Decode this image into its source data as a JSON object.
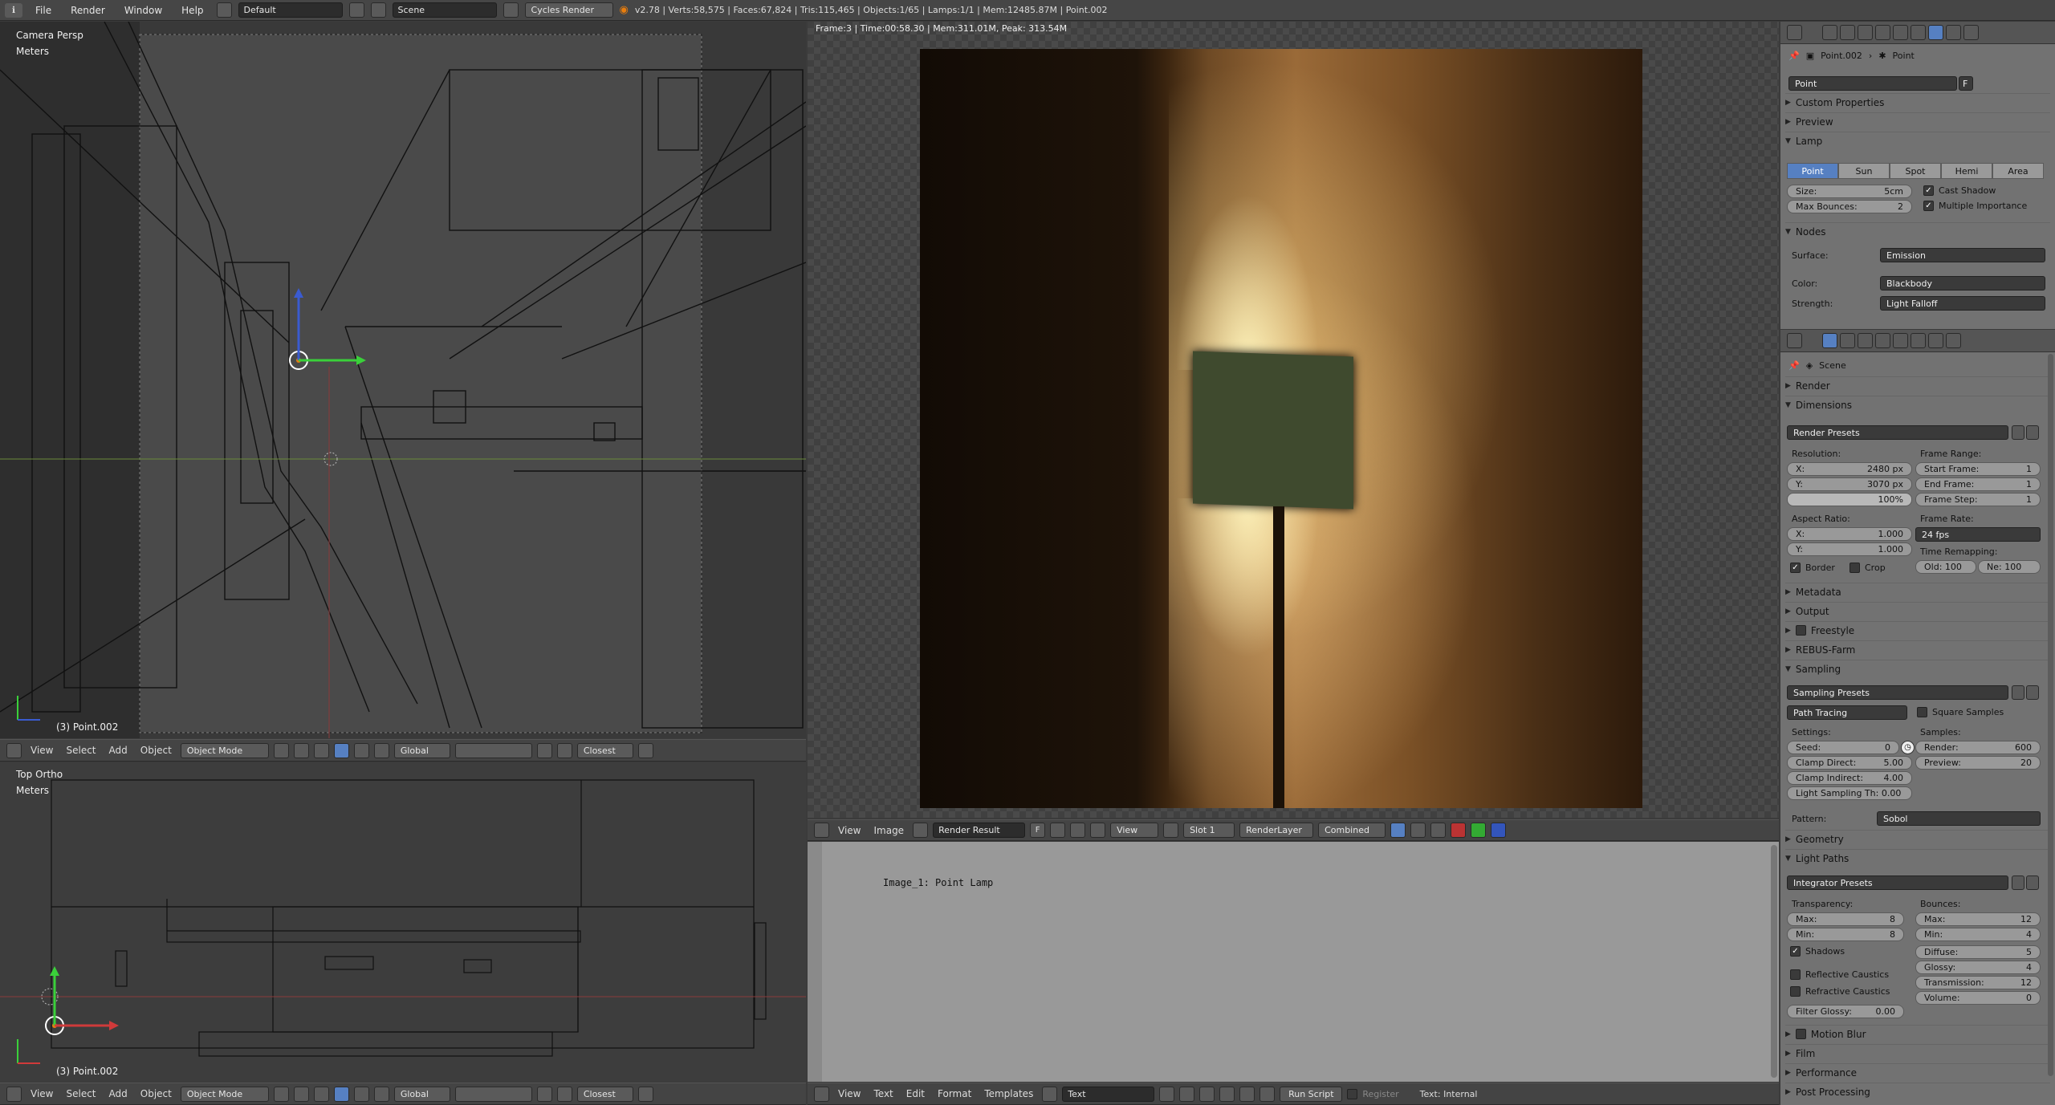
{
  "topbar": {
    "menus": [
      "File",
      "Render",
      "Window",
      "Help"
    ],
    "layout": "Default",
    "scene": "Scene",
    "engine": "Cycles Render",
    "stats": "v2.78 | Verts:58,575 | Faces:67,824 | Tris:115,465 | Objects:1/65 | Lamps:1/1 | Mem:12485.87M | Point.002"
  },
  "vp_top": {
    "title": "Camera Persp",
    "units": "Meters",
    "object": "(3) Point.002"
  },
  "vp_bottom": {
    "title": "Top Ortho",
    "units": "Meters",
    "object": "(3) Point.002"
  },
  "view3d_header": {
    "menus": [
      "View",
      "Select",
      "Add",
      "Object"
    ],
    "mode": "Object Mode",
    "orientation": "Global",
    "snap": "Closest"
  },
  "render": {
    "info": "Frame:3 | Time:00:58.30 | Mem:311.01M, Peak: 313.54M"
  },
  "image_header": {
    "menus": [
      "View",
      "Image"
    ],
    "image": "Render Result",
    "fake": "F",
    "view": "View",
    "slot": "Slot 1",
    "layer": "RenderLayer",
    "pass": "Combined"
  },
  "text_editor": {
    "content": "Image_1: Point Lamp"
  },
  "text_header": {
    "menus": [
      "View",
      "Text",
      "Edit",
      "Format",
      "Templates"
    ],
    "datablock": "Text",
    "run": "Run Script",
    "register": "Register",
    "status": "Text: Internal"
  },
  "lamp_props": {
    "breadcrumb_obj": "Point.002",
    "breadcrumb_lamp": "Point",
    "name": "Point",
    "fake": "F",
    "custom": "Custom Properties",
    "preview": "Preview",
    "lamp_section": "Lamp",
    "types": [
      "Point",
      "Sun",
      "Spot",
      "Hemi",
      "Area"
    ],
    "size_label": "Size:",
    "size_val": "5cm",
    "bounces_label": "Max Bounces:",
    "bounces_val": "2",
    "cast_shadow": "Cast Shadow",
    "multi_imp": "Multiple Importance",
    "nodes": "Nodes",
    "surface_label": "Surface:",
    "surface_val": "Emission",
    "color_label": "Color:",
    "color_val": "Blackbody",
    "strength_label": "Strength:",
    "strength_val": "Light Falloff"
  },
  "render_props": {
    "scene": "Scene",
    "render": "Render",
    "dimensions": "Dimensions",
    "render_presets": "Render Presets",
    "resolution": "Resolution:",
    "res_x_label": "X:",
    "res_x": "2480 px",
    "res_y_label": "Y:",
    "res_y": "3070 px",
    "res_pct": "100%",
    "frame_range": "Frame Range:",
    "start_label": "Start Frame:",
    "start": "1",
    "end_label": "End Frame:",
    "end": "1",
    "step_label": "Frame Step:",
    "step": "1",
    "aspect": "Aspect Ratio:",
    "asp_x_label": "X:",
    "asp_x": "1.000",
    "asp_y_label": "Y:",
    "asp_y": "1.000",
    "frame_rate": "Frame Rate:",
    "fps": "24 fps",
    "time_remap": "Time Remapping:",
    "old": "Old: 100",
    "new": "Ne: 100",
    "border": "Border",
    "crop": "Crop",
    "metadata": "Metadata",
    "output": "Output",
    "freestyle": "Freestyle",
    "rebus": "REBUS-Farm",
    "sampling": "Sampling",
    "sampling_presets": "Sampling Presets",
    "integrator": "Path Tracing",
    "square_samples": "Square Samples",
    "settings": "Settings:",
    "samples": "Samples:",
    "seed_label": "Seed:",
    "seed": "0",
    "clamp_d_label": "Clamp Direct:",
    "clamp_d": "5.00",
    "clamp_i_label": "Clamp Indirect:",
    "clamp_i": "4.00",
    "lsth": "Light Sampling Th: 0.00",
    "render_s_label": "Render:",
    "render_s": "600",
    "preview_s_label": "Preview:",
    "preview_s": "20",
    "pattern_label": "Pattern:",
    "pattern": "Sobol",
    "geometry": "Geometry",
    "light_paths": "Light Paths",
    "integrator_presets": "Integrator Presets",
    "transparency": "Transparency:",
    "bounces": "Bounces:",
    "t_max_label": "Max:",
    "t_max": "8",
    "t_min_label": "Min:",
    "t_min": "8",
    "b_max_label": "Max:",
    "b_max": "12",
    "b_min_label": "Min:",
    "b_min": "4",
    "shadows": "Shadows",
    "diffuse_label": "Diffuse:",
    "diffuse": "5",
    "glossy_label": "Glossy:",
    "glossy": "4",
    "transmission_label": "Transmission:",
    "transmission": "12",
    "volume_label": "Volume:",
    "volume": "0",
    "refl_caustics": "Reflective Caustics",
    "refr_caustics": "Refractive Caustics",
    "filter_glossy": "Filter Glossy:",
    "filter_glossy_val": "0.00",
    "motion_blur": "Motion Blur",
    "film": "Film",
    "performance": "Performance",
    "post": "Post Processing"
  }
}
